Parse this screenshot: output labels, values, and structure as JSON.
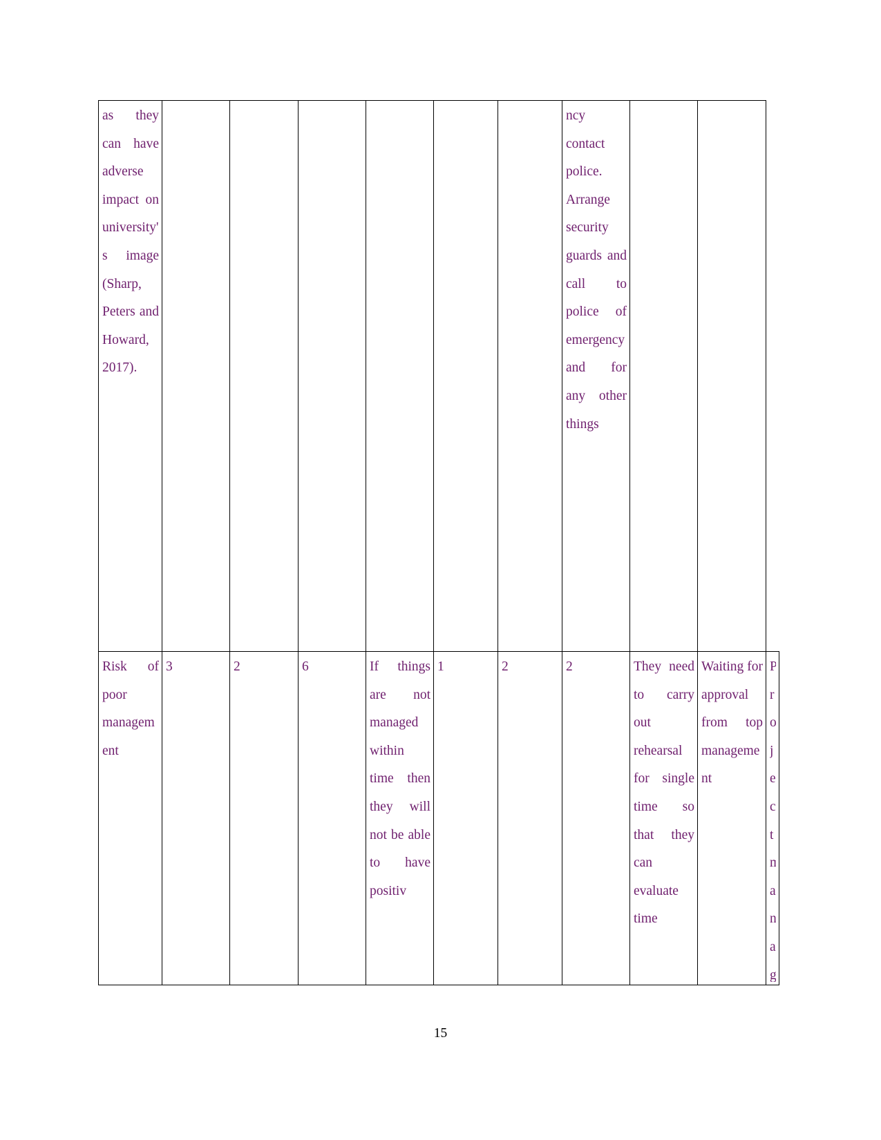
{
  "document": {
    "page_number": "15",
    "text_color": "#70216F",
    "border_color": "#000000",
    "background_color": "#FFFFFF"
  },
  "table": {
    "column_count": 10,
    "rows": [
      {
        "id": "row-continued-reputation-risk",
        "cells": [
          "as they can have adverse impact on university's image (Sharp, Peters and Howard, 2017).",
          "",
          "",
          "",
          "",
          "",
          "",
          "ncy contact police. Arrange security guards and call to police of emergency and for any other things",
          "",
          ""
        ]
      },
      {
        "id": "row-risk-of-poor-management",
        "cells": [
          "Risk of poor management",
          "3",
          "2",
          "6",
          "If things are not managed within time then they will not be able to have positiv",
          "1",
          "2",
          "2",
          "They need to carry out rehearsal for single time so that they can evaluate time",
          "Waiting for approval from top management",
          "Project manager"
        ]
      }
    ]
  }
}
